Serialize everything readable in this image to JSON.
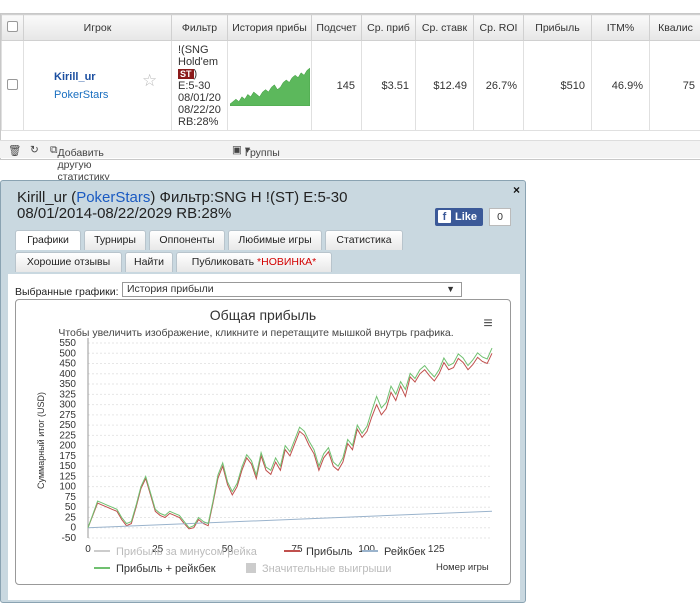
{
  "table": {
    "headers": [
      "Игрок",
      "Фильтр",
      "История прибы",
      "Подсчет",
      "Ср. приб",
      "Ср. ставк",
      "Ср. ROI",
      "Прибыль",
      "ITM%",
      "Квалис"
    ],
    "row": {
      "player": "Kirill_ur",
      "site": "PokerStars",
      "filter_lines": [
        "!(SNG",
        "Hold'em",
        "",
        "E:5-30",
        "08/01/20",
        "08/22/20",
        "RB:28%"
      ],
      "filter_badge": "ST",
      "count": "145",
      "avg_profit": "$3.51",
      "avg_stake": "$12.49",
      "avg_roi": "26.7%",
      "profit": "$510",
      "itm": "46.9%",
      "qual": "75"
    },
    "sparkline": [
      0,
      1,
      2,
      1,
      3,
      2,
      4,
      3,
      5,
      4,
      3,
      5,
      6,
      5,
      7,
      8,
      6,
      7,
      9,
      10,
      9,
      11,
      12,
      11,
      13,
      12,
      14,
      15
    ]
  },
  "toolbar": {
    "add_stats": "Добавить другую статистику",
    "groups": "Группы"
  },
  "dialog": {
    "title_player": "Kirill_ur (",
    "title_site": "PokerStars",
    "title_rest": ") Фильтр:SNG H !(ST) E:5-30 08/01/2014-08/22/2029 RB:28%",
    "like": "Like",
    "like_count": "0",
    "close": "×",
    "tabs_row1": [
      "Графики",
      "Турниры",
      "Оппоненты",
      "Любимые игры",
      "Статистика"
    ],
    "tabs_row2": [
      "Хорошие отзывы",
      "Найти",
      "Публиковать "
    ],
    "new_badge": "*НОВИНКА*",
    "selected_label": "Выбранные графики:",
    "selected_value": "История прибыли"
  },
  "chart_data": {
    "type": "line",
    "title": "Общая прибыль",
    "subtitle": "Чтобы увеличить изображение, кликните и перетащите мышкой внутрь графика.",
    "ylabel": "Суммарный итог (USD)",
    "xlabel": "Номер игры",
    "xlim": [
      0,
      145
    ],
    "ylim": [
      -50,
      550
    ],
    "x_ticks": [
      0,
      25,
      50,
      75,
      100,
      125
    ],
    "y_ticks": [
      -50,
      0,
      25,
      50,
      75,
      100,
      125,
      150,
      175,
      200,
      225,
      250,
      275,
      300,
      325,
      350,
      400,
      450,
      500,
      550
    ],
    "legend": [
      "Прибыль за минусом рейка",
      "Прибыль",
      "Рейкбек",
      "Прибыль + рейкбек",
      "Значительные выигрыши"
    ],
    "colors": {
      "profit": "#c0504d",
      "rakeback": "#9ab3cc",
      "total": "#70c070",
      "minus": "#cccccc"
    },
    "series": [
      {
        "name": "Прибыль",
        "values": [
          0,
          30,
          60,
          55,
          50,
          45,
          40,
          20,
          5,
          10,
          50,
          95,
          120,
          80,
          40,
          30,
          25,
          35,
          30,
          25,
          10,
          -5,
          0,
          20,
          10,
          5,
          60,
          120,
          150,
          105,
          80,
          100,
          140,
          170,
          155,
          120,
          175,
          140,
          130,
          160,
          140,
          190,
          175,
          205,
          235,
          225,
          200,
          180,
          140,
          170,
          185,
          150,
          140,
          160,
          205,
          190,
          240,
          220,
          235,
          270,
          300,
          275,
          290,
          330,
          310,
          345,
          320,
          385,
          360,
          400,
          420,
          390,
          365,
          400,
          455,
          420,
          430,
          475,
          455,
          420,
          445,
          480,
          460,
          450,
          500
        ]
      },
      {
        "name": "Рейкбек",
        "values": [
          0,
          40
        ]
      },
      {
        "name": "Прибыль + рейкбек",
        "values": [
          0,
          32,
          65,
          60,
          55,
          50,
          45,
          25,
          10,
          15,
          55,
          100,
          125,
          85,
          45,
          35,
          30,
          40,
          35,
          30,
          15,
          0,
          5,
          25,
          15,
          10,
          65,
          128,
          158,
          112,
          88,
          108,
          148,
          178,
          163,
          128,
          183,
          148,
          140,
          170,
          150,
          200,
          185,
          215,
          245,
          235,
          210,
          190,
          150,
          180,
          195,
          160,
          150,
          170,
          215,
          200,
          250,
          230,
          247,
          285,
          320,
          292,
          305,
          345,
          325,
          362,
          337,
          402,
          377,
          420,
          440,
          410,
          385,
          420,
          477,
          440,
          452,
          497,
          477,
          440,
          467,
          502,
          482,
          472,
          525
        ]
      }
    ]
  }
}
